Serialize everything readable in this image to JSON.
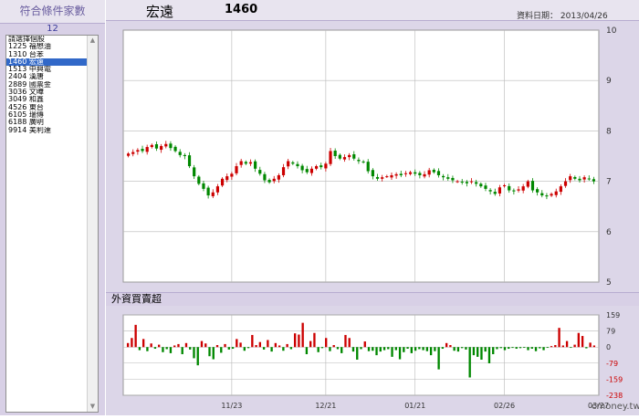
{
  "sidebar": {
    "title": "符合條件家數",
    "count": "12",
    "items": [
      {
        "label": "請選擇個股"
      },
      {
        "label": "1225 福懋油"
      },
      {
        "label": "1310 台苯"
      },
      {
        "label": "1460 宏遠",
        "selected": true
      },
      {
        "label": "1513 中興電"
      },
      {
        "label": "2404 漢唐"
      },
      {
        "label": "2889 國票金"
      },
      {
        "label": "3036 文曄"
      },
      {
        "label": "3049 和鑫"
      },
      {
        "label": "4526 東台"
      },
      {
        "label": "6105 瑞傳"
      },
      {
        "label": "6188 廣明"
      },
      {
        "label": "9914 美利達"
      }
    ]
  },
  "header": {
    "stock_name": "宏遠",
    "stock_code": "1460",
    "date_text": "資料日期： 2013/04/26"
  },
  "sub_panel": {
    "title": "外資買賣超"
  },
  "watermark": "cmoney.tw",
  "colors": {
    "up": "#cc0000",
    "down": "#008800",
    "grid": "#b8b8b8",
    "panel": "#dcd6e8"
  },
  "chart_data": [
    {
      "type": "candlestick",
      "ylim": [
        5,
        10
      ],
      "yticks": [
        "10",
        "9",
        "8",
        "7",
        "6",
        "5"
      ],
      "close": [
        7.55,
        7.58,
        7.62,
        7.6,
        7.68,
        7.72,
        7.65,
        7.7,
        7.74,
        7.66,
        7.6,
        7.52,
        7.5,
        7.3,
        7.1,
        6.95,
        6.85,
        6.72,
        6.78,
        6.9,
        7.05,
        7.1,
        7.15,
        7.3,
        7.4,
        7.35,
        7.38,
        7.25,
        7.15,
        7.02,
        6.98,
        7.05,
        7.12,
        7.28,
        7.4,
        7.35,
        7.3,
        7.22,
        7.18,
        7.25,
        7.3,
        7.28,
        7.35,
        7.6,
        7.5,
        7.45,
        7.48,
        7.52,
        7.45,
        7.4,
        7.38,
        7.2,
        7.1,
        7.05,
        7.08,
        7.1,
        7.12,
        7.14,
        7.12,
        7.16,
        7.18,
        7.15,
        7.12,
        7.14,
        7.22,
        7.18,
        7.12,
        7.08,
        7.05,
        7.02,
        7.0,
        6.98,
        6.96,
        7.0,
        6.95,
        6.9,
        6.85,
        6.8,
        6.75,
        6.88,
        6.92,
        6.82,
        6.8,
        6.84,
        6.9,
        7.0,
        6.82,
        6.78,
        6.72,
        6.7,
        6.75,
        6.8,
        6.9,
        7.0,
        7.1,
        7.05,
        7.02,
        7.08,
        7.05,
        7.0
      ],
      "volume_panel": {
        "type": "bar",
        "name": "外資買賣超",
        "ylim": [
          -238,
          159
        ],
        "yticks": [
          "159",
          "79",
          "0",
          "-79",
          "-159",
          "-238"
        ],
        "x_tick_labels": [
          "11/23",
          "12/21",
          "01/21",
          "02/26",
          "03/27"
        ],
        "x_tick_index": [
          22,
          42,
          61,
          80,
          100
        ],
        "values": [
          20,
          45,
          110,
          -15,
          40,
          -20,
          18,
          -8,
          12,
          -25,
          -10,
          -30,
          8,
          15,
          -35,
          20,
          -12,
          -55,
          -90,
          30,
          18,
          -45,
          -60,
          10,
          -28,
          15,
          -12,
          -8,
          40,
          22,
          -18,
          -5,
          60,
          10,
          25,
          -12,
          35,
          -22,
          20,
          8,
          -18,
          15,
          -10,
          68,
          62,
          120,
          -35,
          30,
          70,
          -25,
          -5,
          45,
          -20,
          10,
          -10,
          -30,
          60,
          45,
          -22,
          -62,
          -10,
          28,
          -20,
          -18,
          -40,
          -22,
          -15,
          -10,
          -48,
          -15,
          -60,
          -25,
          -8,
          -30,
          -18,
          -10,
          -15,
          -20,
          -40,
          -20,
          -110,
          -8,
          20,
          10,
          -18,
          -22,
          -5,
          -12,
          -150,
          -40,
          -48,
          -62,
          -22,
          -80,
          -35,
          -10,
          -5,
          -15,
          -8,
          -4,
          -8,
          -5,
          -2,
          -15,
          -8,
          -20,
          -6,
          -15,
          -3,
          5,
          10,
          95,
          8,
          30,
          -2,
          12,
          70,
          55,
          -6,
          22,
          8
        ]
      }
    }
  ]
}
